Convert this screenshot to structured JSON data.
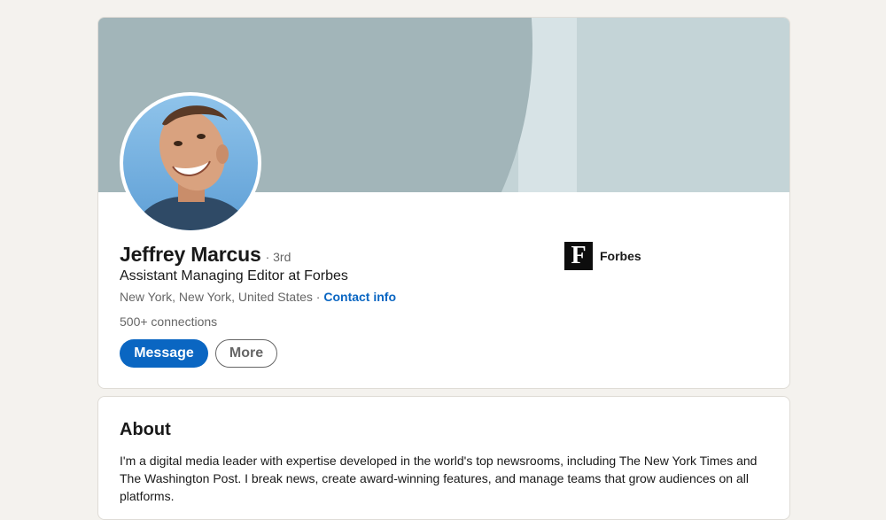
{
  "profile": {
    "name": "Jeffrey Marcus",
    "degree": "· 3rd",
    "headline": "Assistant Managing Editor at Forbes",
    "location": "New York, New York, United States",
    "location_separator": " · ",
    "contact_info_label": "Contact info",
    "connections": "500+ connections",
    "avatar_icon": "profile-photo",
    "banner_colors": {
      "base": "#c4d4d7",
      "arc": "#a2b5b9",
      "band": "#d7e3e6"
    }
  },
  "actions": {
    "message_label": "Message",
    "more_label": "More"
  },
  "company": {
    "logo_letter": "F",
    "name": "Forbes"
  },
  "about": {
    "title": "About",
    "text": "I'm a digital media leader with expertise developed in the world's top newsrooms, including The New York Times and The Washington Post. I break news, create award-winning features, and manage teams that grow audiences on all platforms."
  },
  "colors": {
    "accent": "#0a66c2",
    "page_background": "#f4f2ee"
  }
}
